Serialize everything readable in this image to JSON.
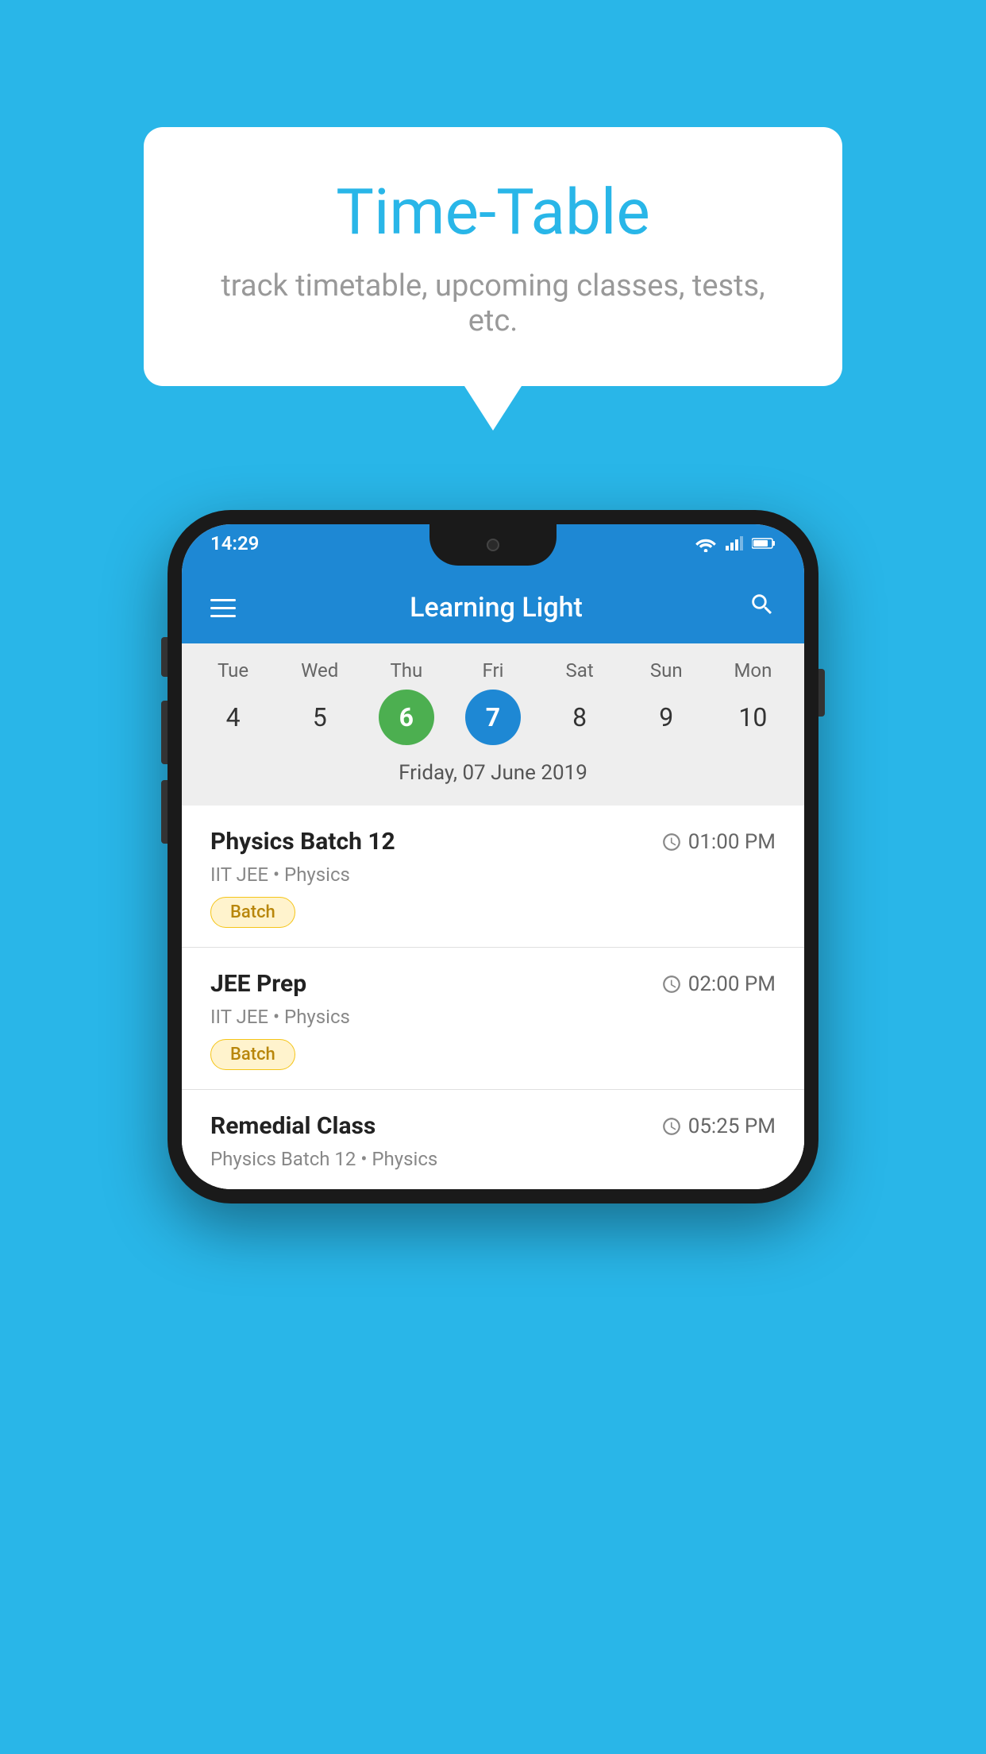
{
  "header": {
    "title": "Time-Table",
    "subtitle": "track timetable, upcoming classes, tests, etc."
  },
  "app": {
    "title": "Learning Light",
    "status_time": "14:29"
  },
  "calendar": {
    "days": [
      {
        "label": "Tue",
        "num": "4",
        "state": "normal"
      },
      {
        "label": "Wed",
        "num": "5",
        "state": "normal"
      },
      {
        "label": "Thu",
        "num": "6",
        "state": "today"
      },
      {
        "label": "Fri",
        "num": "7",
        "state": "selected"
      },
      {
        "label": "Sat",
        "num": "8",
        "state": "normal"
      },
      {
        "label": "Sun",
        "num": "9",
        "state": "normal"
      },
      {
        "label": "Mon",
        "num": "10",
        "state": "normal"
      }
    ],
    "selected_date_label": "Friday, 07 June 2019"
  },
  "classes": [
    {
      "name": "Physics Batch 12",
      "time": "01:00 PM",
      "meta": "IIT JEE • Physics",
      "badge": "Batch"
    },
    {
      "name": "JEE Prep",
      "time": "02:00 PM",
      "meta": "IIT JEE • Physics",
      "badge": "Batch"
    },
    {
      "name": "Remedial Class",
      "time": "05:25 PM",
      "meta": "Physics Batch 12 • Physics",
      "badge": null
    }
  ],
  "icons": {
    "hamburger": "≡",
    "search": "🔍",
    "clock": "🕐"
  }
}
